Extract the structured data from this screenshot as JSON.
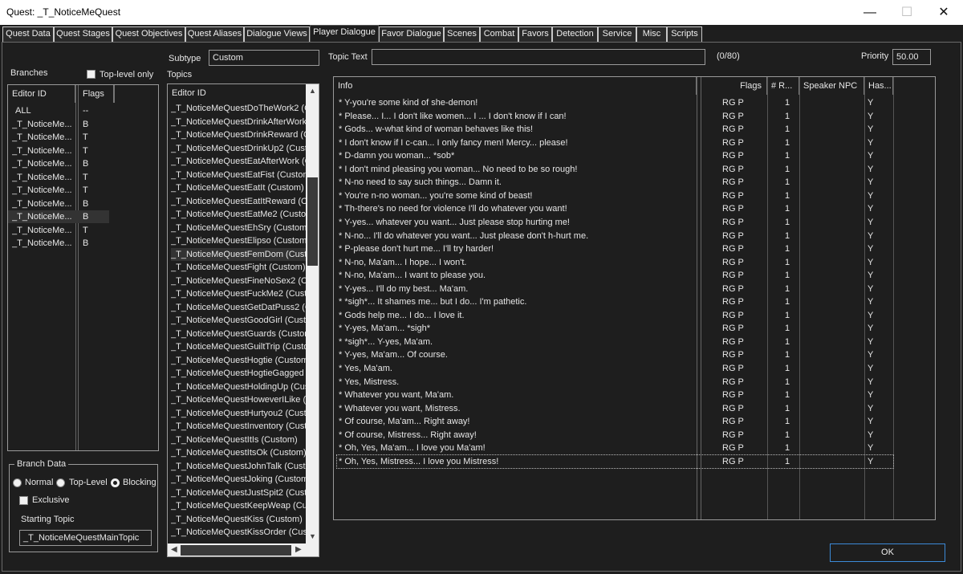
{
  "window": {
    "title": "Quest: _T_NoticeMeQuest",
    "minimize": "—",
    "maximize": "☐",
    "close": "✕"
  },
  "tabs": [
    {
      "label": "Quest Data"
    },
    {
      "label": "Quest Stages"
    },
    {
      "label": "Quest Objectives"
    },
    {
      "label": "Quest Aliases"
    },
    {
      "label": "Dialogue Views"
    },
    {
      "label": "Player Dialogue"
    },
    {
      "label": "Favor Dialogue"
    },
    {
      "label": "Scenes"
    },
    {
      "label": "Combat"
    },
    {
      "label": "Favors"
    },
    {
      "label": "Detection"
    },
    {
      "label": "Service"
    },
    {
      "label": "Misc"
    },
    {
      "label": "Scripts"
    }
  ],
  "branches": {
    "label": "Branches",
    "toplevel_label": "Top-level only",
    "columns": [
      "Editor ID",
      "Flags"
    ],
    "rows": [
      {
        "id": "ALL",
        "flags": "--"
      },
      {
        "id": "_T_NoticeMe...",
        "flags": "B"
      },
      {
        "id": "_T_NoticeMe...",
        "flags": "T"
      },
      {
        "id": "_T_NoticeMe...",
        "flags": "T"
      },
      {
        "id": "_T_NoticeMe...",
        "flags": "B"
      },
      {
        "id": "_T_NoticeMe...",
        "flags": "T"
      },
      {
        "id": "_T_NoticeMe...",
        "flags": "T"
      },
      {
        "id": "_T_NoticeMe...",
        "flags": "B"
      },
      {
        "id": "_T_NoticeMe...",
        "flags": "B"
      },
      {
        "id": "_T_NoticeMe...",
        "flags": "T"
      },
      {
        "id": "_T_NoticeMe...",
        "flags": "B"
      }
    ]
  },
  "branch_data": {
    "label": "Branch Data",
    "normal": "Normal",
    "toplevel": "Top-Level",
    "blocking": "Blocking",
    "exclusive": "Exclusive",
    "starting_topic_label": "Starting Topic",
    "starting_topic_value": "_T_NoticeMeQuestMainTopic"
  },
  "subtype": {
    "label": "Subtype",
    "value": "Custom"
  },
  "topics": {
    "label": "Topics",
    "column": "Editor ID",
    "rows": [
      "_T_NoticeMeQuestDoTheWork2 (C",
      "_T_NoticeMeQuestDrinkAfterWork",
      "_T_NoticeMeQuestDrinkReward (C",
      "_T_NoticeMeQuestDrinkUp2 (Custo",
      "_T_NoticeMeQuestEatAfterWork (C",
      "_T_NoticeMeQuestEatFist (Custom)",
      "_T_NoticeMeQuestEatIt (Custom)",
      "_T_NoticeMeQuestEatItReward (Cu",
      "_T_NoticeMeQuestEatMe2 (Custom",
      "_T_NoticeMeQuestEhSry (Custom)",
      "_T_NoticeMeQuestElipso (Custom)",
      "_T_NoticeMeQuestFemDom (Custo",
      "_T_NoticeMeQuestFight (Custom)",
      "_T_NoticeMeQuestFineNoSex2 (Cu",
      "_T_NoticeMeQuestFuckMe2 (Custo",
      "_T_NoticeMeQuestGetDatPuss2 (C",
      "_T_NoticeMeQuestGoodGirl (Custor",
      "_T_NoticeMeQuestGuards (Custom)",
      "_T_NoticeMeQuestGuiltTrip (Custon",
      "_T_NoticeMeQuestHogtie (Custom)",
      "_T_NoticeMeQuestHogtieGagged (",
      "_T_NoticeMeQuestHoldingUp (Cust",
      "_T_NoticeMeQuestHoweverILike (C",
      "_T_NoticeMeQuestHurtyou2 (Custo",
      "_T_NoticeMeQuestInventory (Custo",
      "_T_NoticeMeQuestItIs (Custom)",
      "_T_NoticeMeQuestItsOk (Custom)",
      "_T_NoticeMeQuestJohnTalk (Custo",
      "_T_NoticeMeQuestJoking (Custom)",
      "_T_NoticeMeQuestJustSpit2 (Custo",
      "_T_NoticeMeQuestKeepWeap (Cus",
      "_T_NoticeMeQuestKiss (Custom)",
      "_T_NoticeMeQuestKissOrder (Custo"
    ]
  },
  "topic_text": {
    "label": "Topic Text",
    "value": "",
    "counter": "(0/80)"
  },
  "priority": {
    "label": "Priority",
    "value": "50.00"
  },
  "info": {
    "columns": [
      "Info",
      "Flags",
      "# R...",
      "Speaker NPC",
      "Has..."
    ],
    "rows": [
      {
        "text": "* Y-you're some kind of she-demon!",
        "flags": "RG  P",
        "r": "1",
        "speaker": "",
        "has": "Y"
      },
      {
        "text": "* Please... I... I don't like women... I ... I don't know if I can!",
        "flags": "RG  P",
        "r": "1",
        "speaker": "",
        "has": "Y"
      },
      {
        "text": "* Gods... w-what kind of woman behaves like this!",
        "flags": "RG  P",
        "r": "1",
        "speaker": "",
        "has": "Y"
      },
      {
        "text": "* I don't know if I c-can... I only fancy men! Mercy... please!",
        "flags": "RG  P",
        "r": "1",
        "speaker": "",
        "has": "Y"
      },
      {
        "text": "* D-damn you woman... *sob*",
        "flags": "RG  P",
        "r": "1",
        "speaker": "",
        "has": "Y"
      },
      {
        "text": "* I don't mind pleasing you woman... No need to be so rough!",
        "flags": "RG  P",
        "r": "1",
        "speaker": "",
        "has": "Y"
      },
      {
        "text": "* N-no need to say such things... Damn it.",
        "flags": "RG  P",
        "r": "1",
        "speaker": "",
        "has": "Y"
      },
      {
        "text": "* You're n-no woman... you're some kind of beast!",
        "flags": "RG  P",
        "r": "1",
        "speaker": "",
        "has": "Y"
      },
      {
        "text": "* Th-there's no need for violence I'll do whatever you want!",
        "flags": "RG  P",
        "r": "1",
        "speaker": "",
        "has": "Y"
      },
      {
        "text": "* Y-yes... whatever you want... Just please stop hurting me!",
        "flags": "RG  P",
        "r": "1",
        "speaker": "",
        "has": "Y"
      },
      {
        "text": "* N-no... I'll do whatever you want... Just please don't h-hurt me.",
        "flags": "RG  P",
        "r": "1",
        "speaker": "",
        "has": "Y"
      },
      {
        "text": "* P-please don't hurt me... I'll try harder!",
        "flags": "RG  P",
        "r": "1",
        "speaker": "",
        "has": "Y"
      },
      {
        "text": "* N-no, Ma'am... I hope... I won't.",
        "flags": "RG  P",
        "r": "1",
        "speaker": "",
        "has": "Y"
      },
      {
        "text": "* N-no, Ma'am... I want to please you.",
        "flags": "RG  P",
        "r": "1",
        "speaker": "",
        "has": "Y"
      },
      {
        "text": "* Y-yes... I'll do my best... Ma'am.",
        "flags": "RG  P",
        "r": "1",
        "speaker": "",
        "has": "Y"
      },
      {
        "text": "* *sigh*... It shames me... but I do... I'm pathetic.",
        "flags": "RG  P",
        "r": "1",
        "speaker": "",
        "has": "Y"
      },
      {
        "text": "* Gods help me... I do... I love it.",
        "flags": "RG  P",
        "r": "1",
        "speaker": "",
        "has": "Y"
      },
      {
        "text": "* Y-yes, Ma'am... *sigh*",
        "flags": "RG  P",
        "r": "1",
        "speaker": "",
        "has": "Y"
      },
      {
        "text": "*  *sigh*... Y-yes, Ma'am.",
        "flags": "RG  P",
        "r": "1",
        "speaker": "",
        "has": "Y"
      },
      {
        "text": "* Y-yes, Ma'am... Of course.",
        "flags": "RG  P",
        "r": "1",
        "speaker": "",
        "has": "Y"
      },
      {
        "text": "* Yes, Ma'am.",
        "flags": "RG  P",
        "r": "1",
        "speaker": "",
        "has": "Y"
      },
      {
        "text": "* Yes, Mistress.",
        "flags": "RG  P",
        "r": "1",
        "speaker": "",
        "has": "Y"
      },
      {
        "text": "* Whatever you want, Ma'am.",
        "flags": "RG  P",
        "r": "1",
        "speaker": "",
        "has": "Y"
      },
      {
        "text": "* Whatever you want, Mistress.",
        "flags": "RG  P",
        "r": "1",
        "speaker": "",
        "has": "Y"
      },
      {
        "text": "* Of course, Ma'am... Right away!",
        "flags": "RG  P",
        "r": "1",
        "speaker": "",
        "has": "Y"
      },
      {
        "text": "* Of course, Mistress... Right away!",
        "flags": "RG  P",
        "r": "1",
        "speaker": "",
        "has": "Y"
      },
      {
        "text": "* Oh, Yes, Ma'am... I love you Ma'am!",
        "flags": "RG  P",
        "r": "1",
        "speaker": "",
        "has": "Y"
      },
      {
        "text": "* Oh, Yes, Mistress... I love you Mistress!",
        "flags": "RG  P",
        "r": "1",
        "speaker": "",
        "has": "Y"
      }
    ]
  },
  "ok_label": "OK"
}
